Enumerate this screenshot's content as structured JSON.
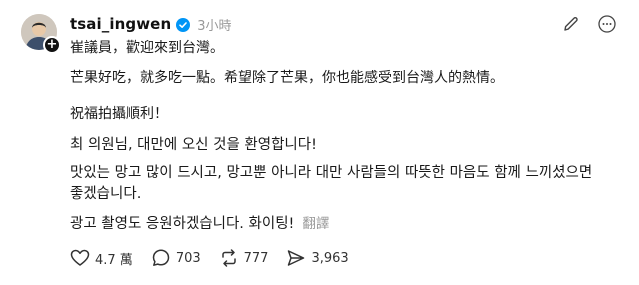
{
  "post": {
    "username": "tsai_ingwen",
    "timestamp": "3小時",
    "paragraphs": [
      "崔議員，歡迎來到台灣。",
      "芒果好吃，就多吃一點。希望除了芒果，你也能感受到台灣人的熱情。",
      "祝福拍攝順利！",
      "최 의원님, 대만에 오신 것을 환영합니다!",
      "맛있는 망고 많이 드시고, 망고뿐 아니라 대만 사람들의 따뜻한 마음도 함께 느끼셨으면 좋겠습니다.",
      "광고 촬영도 응원하겠습니다. 화이팅!"
    ],
    "translate_label": "翻譯",
    "icons": {
      "verified": "verified-badge-icon",
      "edit": "pencil-icon",
      "more": "more-icon",
      "follow": "plus-icon"
    }
  },
  "stats": {
    "likes": "4.7 萬",
    "comments": "703",
    "reposts": "777",
    "shares": "3,963"
  },
  "colors": {
    "text": "#1a1a1a",
    "muted": "#999999",
    "verified": "#0095f6"
  }
}
